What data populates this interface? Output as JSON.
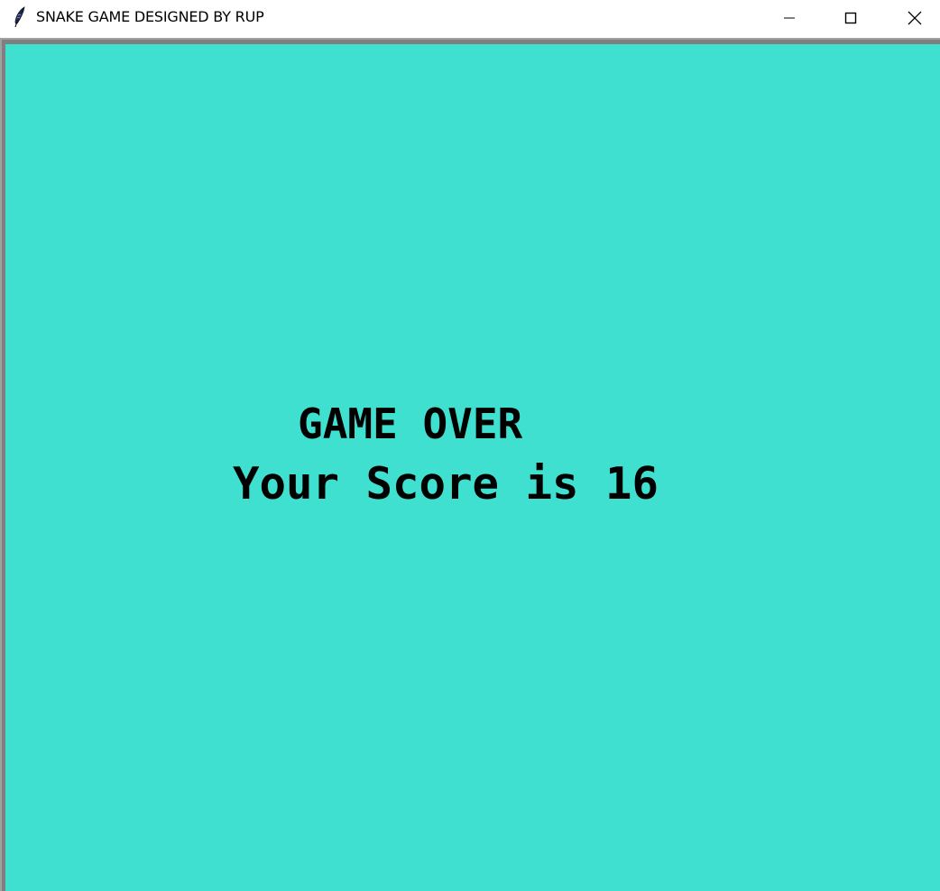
{
  "window": {
    "title": "SNAKE GAME DESIGNED BY RUP",
    "app_icon": "feather-icon",
    "controls": {
      "minimize_icon": "minimize-icon",
      "maximize_icon": "maximize-icon",
      "close_icon": "close-icon"
    }
  },
  "game": {
    "background_color": "#40E0D0",
    "text_color": "#000000",
    "game_over_text": "GAME OVER",
    "score_text": "Your Score is 16"
  }
}
